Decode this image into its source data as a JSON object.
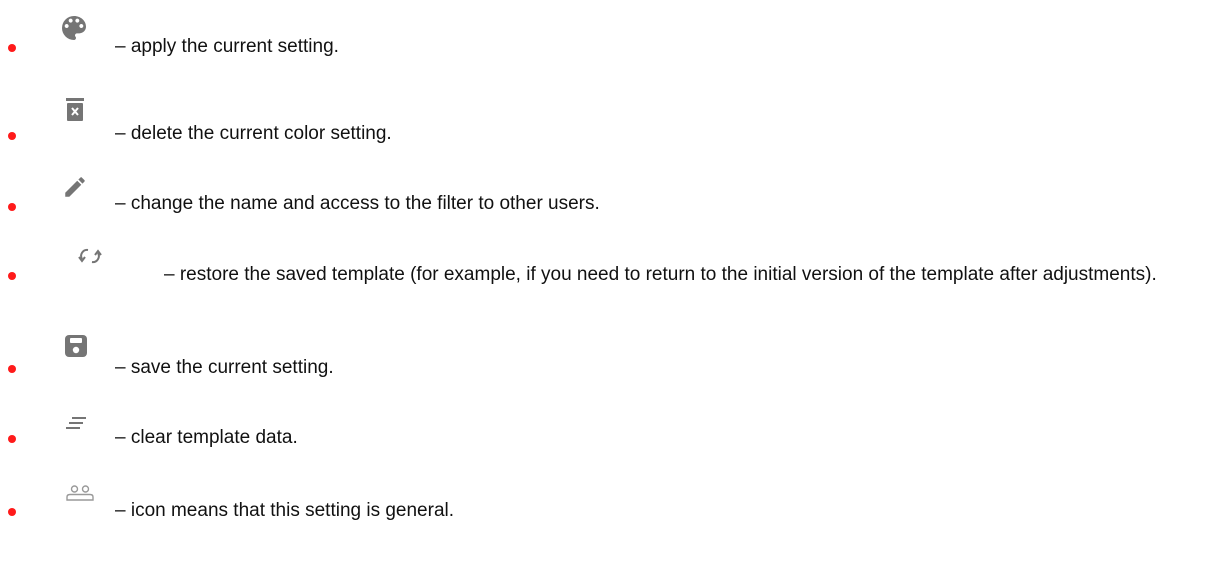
{
  "items": [
    {
      "icon": "palette-icon",
      "text": "– apply the current setting."
    },
    {
      "icon": "delete-bin-icon",
      "text": "– delete the current color setting."
    },
    {
      "icon": "pencil-icon",
      "text": "– change the name and access to the filter to other users."
    },
    {
      "icon": "restore-icon",
      "text": "– restore the saved template (for example, if you need to return to the initial version of the template after adjustments)."
    },
    {
      "icon": "save-icon",
      "text": "– save the current setting."
    },
    {
      "icon": "clear-lines-icon",
      "text": "– clear template data."
    },
    {
      "icon": "group-users-icon",
      "text": "– icon means that this setting is general."
    }
  ],
  "colors": {
    "bullet": "#ff1a1a",
    "icon": "#757575",
    "text": "#111111"
  }
}
